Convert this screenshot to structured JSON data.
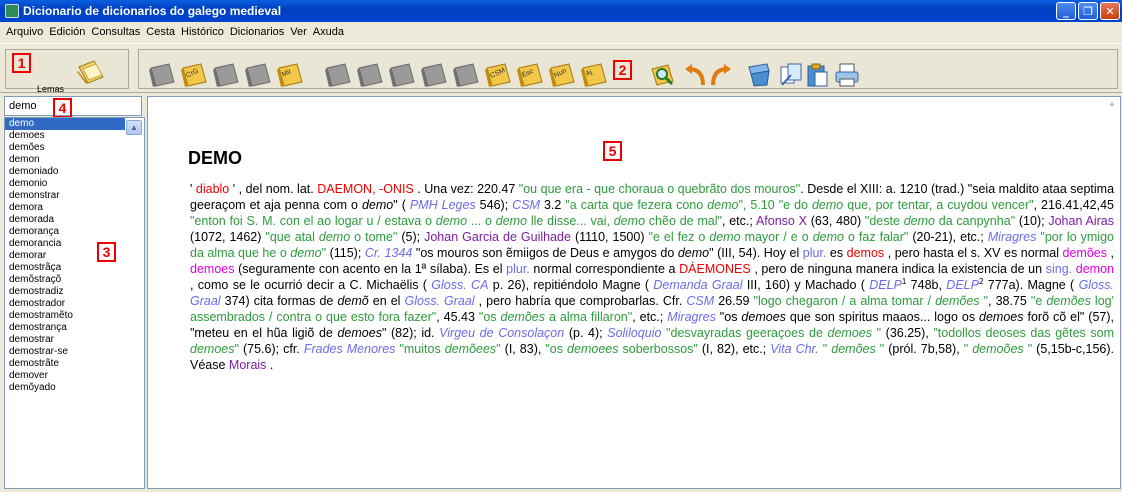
{
  "window": {
    "title": "Dicionario de dicionarios do galego medieval"
  },
  "menu": [
    "Arquivo",
    "Edición",
    "Consultas",
    "Cesta",
    "Histórico",
    "Dicionarios",
    "Ver",
    "Axuda"
  ],
  "toolbar": {
    "lemas_label": "Lemas",
    "book_labels": [
      "CrG",
      "Mir",
      "CSM",
      "Esc",
      "Nun",
      "Aj"
    ]
  },
  "markers": [
    "1",
    "2",
    "3",
    "4",
    "5"
  ],
  "search": {
    "value": "demo"
  },
  "lemma_list": [
    "demo",
    "demoes",
    "demões",
    "demon",
    "demoniado",
    "demonio",
    "demonstrar",
    "demora",
    "demorada",
    "demorança",
    "demorancia",
    "demorar",
    "demostrãça",
    "demõstraçõ",
    "demostradiz",
    "demostrador",
    "demostramẽto",
    "demostrança",
    "demostrar",
    "demostrar-se",
    "demostrãte",
    "demover",
    "demõyado"
  ],
  "article": {
    "headword": "DEMO",
    "p1": "' ",
    "p2": "diablo",
    "p3": " ' , del nom. lat. ",
    "p4": "DAEMON, -ONIS",
    "p5": " . Una vez: 220.47 ",
    "p6": "\"ou que era - que choraua o quebrãto dos mouros\"",
    "p7": ". Desde el XIII: a. 1210 (trad.) \"seia maldito ataa septima geeraçom et aja penna com o ",
    "p8": "demo",
    "p9": "\" ( ",
    "p10": "PMH Leges",
    "p11": " 546); ",
    "p12": "CSM",
    "p13": " 3.2 ",
    "p14": "\"a carta que fezera cono ",
    "p15": "demo",
    "p16": "\", 5.10 ",
    "p17": "\"e do ",
    "p18": "demo",
    "p19": " que, por tentar, a cuydou vencer\"",
    "p20": ", 216.41,42,45 ",
    "p21": "\"enton foi S. M. con el ao logar u / estava o ",
    "p22": "demo",
    "p23": " ... o ",
    "p24": "demo",
    "p25": " lle disse... vai, ",
    "p26": "demo",
    "p27": " chẽo de mal\"",
    "p28": ", etc.; ",
    "p29": "Afonso X",
    "p30": " (63, 480) ",
    "p31": "\"deste ",
    "p32": "demo",
    "p33": " da canpynha\"",
    "p34": " (10); ",
    "p35": "Johan Airas",
    "p36": " (1072, 1462) ",
    "p37": "\"que atal ",
    "p38": "demo",
    "p39": " o tome\"",
    "p40": " (5); ",
    "p41": "Johan Garcia de Guilhade",
    "p42": " (1110, 1500) ",
    "p43": "\"e el fez o ",
    "p44": "demo",
    "p45": " mayor / e o ",
    "p46": "demo",
    "p47": " o faz falar\"",
    "p48": " (20-21), etc.; ",
    "p49": "Miragres",
    "p50": " ",
    "p51": "\"por lo ymigo da alma que he o ",
    "p52": "demo",
    "p53": "\"",
    "p54": " (115); ",
    "p55": "Cr. 1344",
    "p56": " \"os mouros son ẽmiigos de Deus e amygos do ",
    "p57": "demo",
    "p58": "\" (III, 54). Hoy el ",
    "p59": "plur.",
    "p60": " es ",
    "p61": "demos",
    "p62": " , pero hasta el s. XV es normal ",
    "p63": "demões",
    "p64": " , ",
    "p65": "demoes",
    "p66": " (seguramente con acento en la 1ª sílaba). Es el ",
    "p67": "plur.",
    "p68": " normal correspondiente a ",
    "p69": "DÁEMONES",
    "p70": " , pero de ninguna manera indica la existencia de un ",
    "p71": "sing.",
    "p72": " ",
    "p73": "demon",
    "p74": " , como se le ocurrió decir a C. Michaëlis ( ",
    "p75": "Gloss. CA",
    "p76": " p. 26), repitiéndolo Magne ( ",
    "p77": "Demanda Graal",
    "p78": " III, 160) y Machado ( ",
    "p79": "DELP",
    "p80": "1",
    "p81": " 748b, ",
    "p82": "DELP",
    "p83": "2",
    "p84": " 777a). Magne ( ",
    "p85": "Gloss. Graal",
    "p86": " 374) cita formas de ",
    "p87": "demõ",
    "p88": " en el ",
    "p89": "Gloss. Graal",
    "p90": " , pero habría que comprobarlas. Cfr. ",
    "p91": "CSM",
    "p92": " 26.59 ",
    "p93": "\"logo chegaron / a alma tomar / ",
    "p94": "demões",
    "p95": " \"",
    "p96": ", 38.75 ",
    "p97": "\"e ",
    "p98": "demões",
    "p99": " log' assembrados / contra o que esto fora fazer\"",
    "p100": ", 45.43 ",
    "p101": "\"os ",
    "p102": "demões",
    "p103": " a alma fillaron\"",
    "p104": ", etc.; ",
    "p105": "Miragres",
    "p106": " \"os ",
    "p107": "demoes",
    "p108": " que son spiritus maaos... logo os ",
    "p109": "demoes",
    "p110": " forõ cõ el\" (57), \"meteu en el hũa ligiõ de ",
    "p111": "demoes",
    "p112": "\" (82); id. ",
    "p113": "Virgeu de Consolaçon",
    "p114": " (p. 4); ",
    "p115": "Soliloquio",
    "p116": " ",
    "p117": "\"desvayradas geeraçoes de ",
    "p118": "demoes",
    "p119": " \"",
    "p120": " (36.25), ",
    "p121": "\"todollos deoses das gẽtes som ",
    "p122": "demoes",
    "p123": "\"",
    "p124": " (75.6); cfr. ",
    "p125": "Frades Menores",
    "p126": " ",
    "p127": "\"muitos ",
    "p128": "demõees",
    "p129": "\"",
    "p130": " (I, 83), ",
    "p131": "\"os ",
    "p132": "demoees",
    "p133": " soberbossos\"",
    "p134": " (I, 82), etc.; ",
    "p135": "Vita Chr.",
    "p136": " ",
    "p137": "\" ",
    "p138": "demões",
    "p139": " \"",
    "p140": " (pról. 7b,58), ",
    "p141": "\" ",
    "p142": "demoões",
    "p143": " \"",
    "p144": " (5,15b-c,156). Véase ",
    "p145": "Morais",
    "p146": " ."
  }
}
